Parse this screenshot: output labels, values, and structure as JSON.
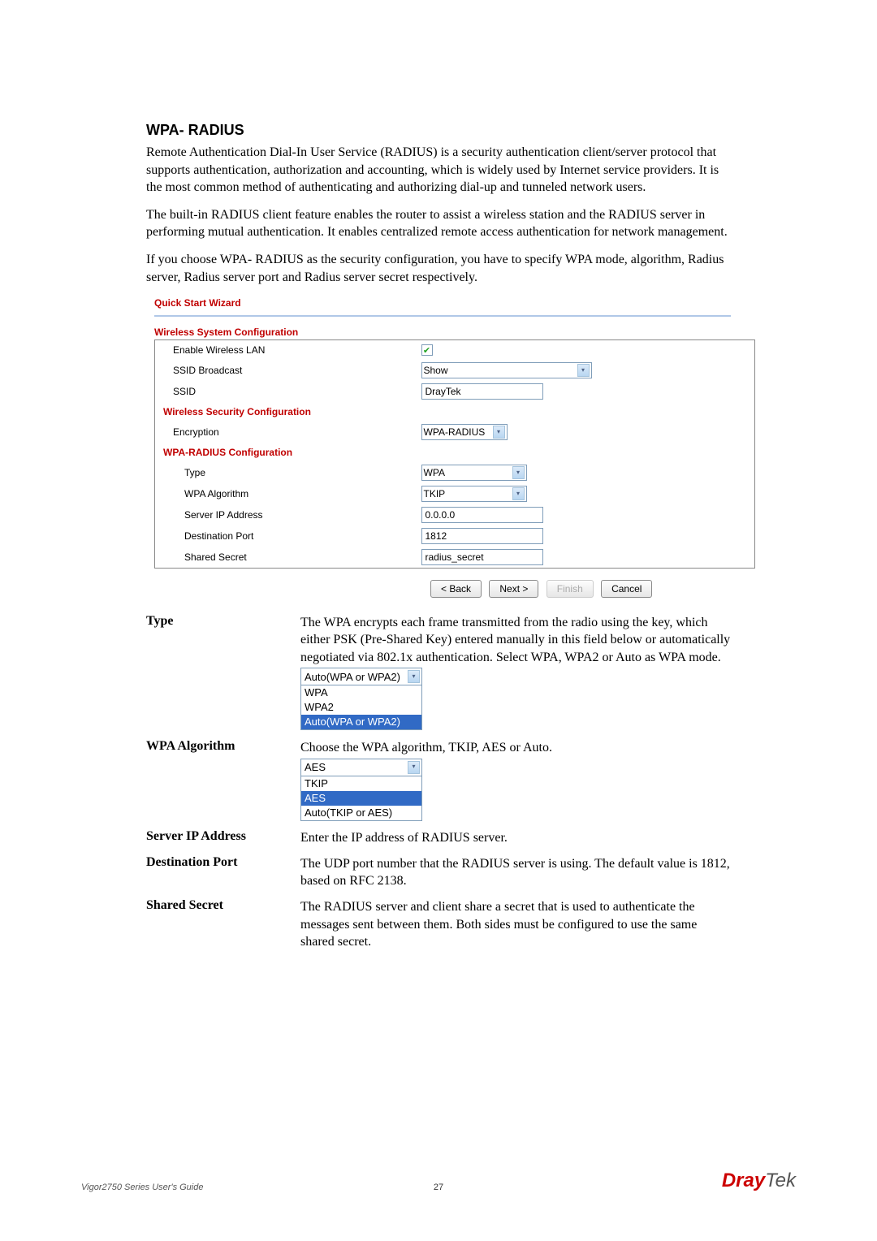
{
  "heading": "WPA- RADIUS",
  "para1": "Remote Authentication Dial-In User Service (RADIUS) is a security authentication client/server protocol that supports authentication, authorization and accounting, which is widely used by Internet service providers. It is the most common method of authenticating and authorizing dial-up and tunneled network users.",
  "para2": "The built-in RADIUS client feature enables the router to assist a wireless station and the RADIUS server in performing mutual authentication. It enables centralized remote access authentication for network management.",
  "para3": "If you choose WPA- RADIUS as the security configuration, you have to specify WPA mode, algorithm, Radius server, Radius server port and Radius server secret respectively.",
  "wizard": {
    "title": "Quick Start Wizard",
    "section1": "Wireless System Configuration",
    "rows1": {
      "enable_label": "Enable Wireless LAN",
      "ssid_broadcast_label": "SSID Broadcast",
      "ssid_broadcast_value": "Show",
      "ssid_label": "SSID",
      "ssid_value": "DrayTek"
    },
    "section2": "Wireless Security Configuration",
    "rows2": {
      "encryption_label": "Encryption",
      "encryption_value": "WPA-RADIUS"
    },
    "section3": "WPA-RADIUS Configuration",
    "rows3": {
      "type_label": "Type",
      "type_value": "WPA",
      "algo_label": "WPA Algorithm",
      "algo_value": "TKIP",
      "server_ip_label": "Server IP Address",
      "server_ip_value": "0.0.0.0",
      "dest_port_label": "Destination Port",
      "dest_port_value": "1812",
      "secret_label": "Shared Secret",
      "secret_value": "radius_secret"
    },
    "buttons": {
      "back": "< Back",
      "next": "Next >",
      "finish": "Finish",
      "cancel": "Cancel"
    }
  },
  "desc": {
    "type_label": "Type",
    "type_body": "The WPA encrypts each frame transmitted from the radio using the key, which either PSK (Pre-Shared Key) entered manually in this field below or automatically negotiated via 802.1x authentication. Select WPA, WPA2 or Auto as WPA mode.",
    "type_dropdown": {
      "selected": "Auto(WPA or WPA2)",
      "opts": [
        "WPA",
        "WPA2",
        "Auto(WPA or WPA2)"
      ]
    },
    "algo_label": "WPA Algorithm",
    "algo_body": "Choose the WPA algorithm, TKIP, AES or Auto.",
    "algo_dropdown": {
      "selected": "AES",
      "opts": [
        "TKIP",
        "AES",
        "Auto(TKIP or AES)"
      ]
    },
    "server_label": "Server IP Address",
    "server_body": "Enter the IP address of RADIUS server.",
    "port_label": "Destination Port",
    "port_body": "The UDP port number that the RADIUS server is using. The default value is 1812, based on RFC 2138.",
    "secret_label": "Shared Secret",
    "secret_body": "The RADIUS server and client share a secret that is used to authenticate the messages sent between them. Both sides must be configured to use the same shared secret."
  },
  "footer": {
    "left": "Vigor2750 Series User's Guide",
    "center": "27",
    "brand1": "Dray",
    "brand2": "Tek"
  }
}
